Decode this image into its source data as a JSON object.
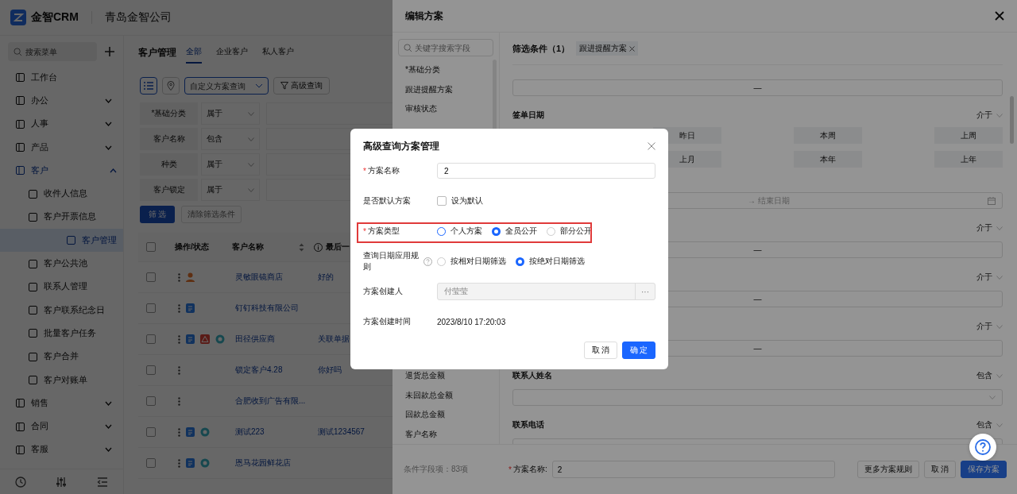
{
  "app": {
    "name": "金智CRM",
    "company": "青岛金智公司"
  },
  "sidebar": {
    "search_placeholder": "搜索菜单",
    "items": [
      {
        "label": "工作台",
        "kind": "link",
        "selected": false
      },
      {
        "label": "办公",
        "kind": "group",
        "selected": false,
        "expanded": false
      },
      {
        "label": "人事",
        "kind": "group",
        "selected": false,
        "expanded": false
      },
      {
        "label": "产品",
        "kind": "group",
        "selected": false,
        "expanded": false
      },
      {
        "label": "客户",
        "kind": "group",
        "selected": true,
        "expanded": true,
        "children": [
          {
            "label": "收件人信息",
            "selected": false
          },
          {
            "label": "客户开票信息",
            "selected": false
          },
          {
            "label": "客户管理",
            "selected": true
          },
          {
            "label": "客户公共池",
            "selected": false
          },
          {
            "label": "联系人管理",
            "selected": false
          },
          {
            "label": "客户联系纪念日",
            "selected": false
          },
          {
            "label": "批量客户任务",
            "selected": false
          },
          {
            "label": "客户合并",
            "selected": false
          },
          {
            "label": "客户对账单",
            "selected": false
          }
        ]
      },
      {
        "label": "销售",
        "kind": "group",
        "selected": false,
        "expanded": false
      },
      {
        "label": "合同",
        "kind": "group",
        "selected": false,
        "expanded": false
      },
      {
        "label": "客服",
        "kind": "group",
        "selected": false,
        "expanded": false
      }
    ]
  },
  "main": {
    "title": "客户管理",
    "tabs": [
      {
        "label": "全部",
        "selected": true
      },
      {
        "label": "企业客户",
        "selected": false
      },
      {
        "label": "私人客户",
        "selected": false
      }
    ],
    "scheme_placeholder": "自定义方案查询",
    "advanced_button": "高级查询",
    "filters": [
      {
        "label": "*基础分类",
        "operator": "属于"
      },
      {
        "label": "客户名称",
        "operator": "包含"
      },
      {
        "label": "种类",
        "operator": "属于"
      },
      {
        "label": "客户锁定",
        "operator": "属于"
      }
    ],
    "filter_button": "筛 选",
    "clear_button": "清除筛选条件",
    "table": {
      "columns": [
        "操作/状态",
        "客户名称",
        "最后一"
      ],
      "header_checked": false,
      "rows": [
        {
          "checked": false,
          "name": "灵敏眼镜商店",
          "last": "好的",
          "status_icons": [
            {
              "kind": "contact"
            }
          ]
        },
        {
          "checked": false,
          "name": "钉钉科技有限公司",
          "status_icons": [
            {
              "kind": "document"
            }
          ]
        },
        {
          "checked": false,
          "name": "田径供应商",
          "last": "关联单据",
          "status_icons": [
            {
              "kind": "document"
            },
            {
              "kind": "alert"
            },
            {
              "kind": "linked"
            }
          ]
        },
        {
          "checked": false,
          "name": "锁定客户4.28",
          "last": "你好吗",
          "status_icons": []
        },
        {
          "checked": false,
          "name": "合肥收到广告有限...",
          "status_icons": []
        },
        {
          "checked": false,
          "name": "测试223",
          "last": "测试1234567",
          "status_icons": [
            {
              "kind": "document"
            },
            {
              "kind": "linked"
            }
          ]
        },
        {
          "checked": false,
          "name": "恩马花园鲜花店",
          "status_icons": [
            {
              "kind": "document"
            },
            {
              "kind": "linked"
            }
          ]
        }
      ]
    }
  },
  "drawer": {
    "title": "编辑方案",
    "search_placeholder": "关键字搜索字段",
    "field_groups": [
      [
        "*基础分类",
        "跟进提醒方案",
        "审核状态"
      ],
      [
        "退货总金额",
        "未回款总金额",
        "回款总金额",
        "客户名称"
      ]
    ],
    "field_count": "条件字段项：83项",
    "conditions_title": "筛选条件（1）",
    "tags": [
      {
        "label": "跟进提醒方案"
      }
    ],
    "conditions": [
      {
        "kind": "range",
        "separator": "—"
      },
      {
        "kind": "date",
        "label": "签单日期",
        "operator": "介于",
        "quick_rows": [
          [
            "昨日",
            "本周",
            "上周"
          ],
          [
            "上月",
            "本年",
            "上年"
          ]
        ],
        "end_placeholder": "结束日期",
        "arrow": "→"
      },
      {
        "kind": "range",
        "operator": "介于",
        "separator": "—"
      },
      {
        "kind": "range",
        "operator": "介于",
        "separator": "—"
      },
      {
        "kind": "range",
        "operator": "介于",
        "separator": "—"
      },
      {
        "kind": "select",
        "label": "联系人姓名",
        "operator": "包含"
      },
      {
        "kind": "input",
        "label": "联系电话",
        "operator": "包含"
      }
    ],
    "name_required_mark": "*",
    "name_label": "方案名称:",
    "name_value": "2",
    "buttons": [
      "更多方案规则",
      "取 消",
      "保存方案"
    ]
  },
  "dialog": {
    "title": "高级查询方案管理",
    "name": {
      "label": "方案名称",
      "required_mark": "*",
      "value": "2"
    },
    "default": {
      "label": "是否默认方案",
      "option": "设为默认",
      "checked": false
    },
    "type": {
      "label": "方案类型",
      "required_mark": "*",
      "highlight": true,
      "options": [
        {
          "label": "个人方案",
          "selected": false
        },
        {
          "label": "全员公开",
          "selected": true
        },
        {
          "label": "部分公开",
          "selected": false
        }
      ]
    },
    "date_rule": {
      "label": "查询日期应用规则",
      "options": [
        {
          "label": "按相对日期筛选",
          "selected": false
        },
        {
          "label": "按绝对日期筛选",
          "selected": true
        }
      ]
    },
    "creator": {
      "label": "方案创建人",
      "value": "付莹莹",
      "disabled": true,
      "more": "···"
    },
    "created": {
      "label": "方案创建时间",
      "value": "2023/8/10 17:20:03"
    },
    "buttons": [
      "取 消",
      "确 定"
    ]
  }
}
